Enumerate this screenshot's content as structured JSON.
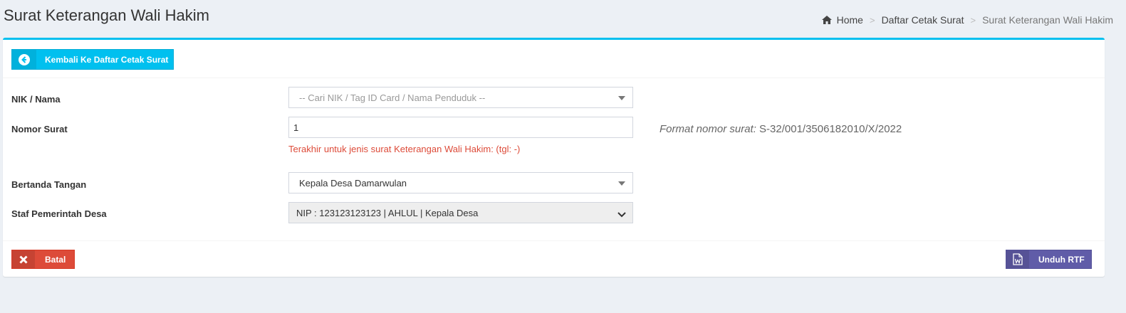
{
  "header": {
    "title": "Surat Keterangan Wali Hakim",
    "breadcrumb": [
      "Home",
      "Daftar Cetak Surat",
      "Surat Keterangan Wali Hakim"
    ],
    "breadcrumb_separator": ">"
  },
  "back_button": {
    "label": "Kembali Ke Daftar Cetak Surat",
    "icon": "arrow-circle-left-icon"
  },
  "form": {
    "nik": {
      "label": "NIK / Nama",
      "placeholder": "-- Cari NIK / Tag ID Card / Nama Penduduk --"
    },
    "nomor": {
      "label": "Nomor Surat",
      "value": "1",
      "help": "Terakhir untuk jenis surat Keterangan Wali Hakim: (tgl: -)",
      "format_label": "Format nomor surat:",
      "format_value": "S-32/001/3506182010/X/2022"
    },
    "ttd": {
      "label": "Bertanda Tangan",
      "value": "Kepala Desa Damarwulan"
    },
    "staf": {
      "label": "Staf Pemerintah Desa",
      "value": "NIP : 123123123123 | AHLUL | Kepala Desa"
    }
  },
  "footer": {
    "cancel_label": "Batal",
    "rtf_label": "Unduh RTF"
  },
  "colors": {
    "info": "#00c0ef",
    "danger": "#dd4b39",
    "purple": "#605ca8",
    "background": "#ecf0f5"
  }
}
